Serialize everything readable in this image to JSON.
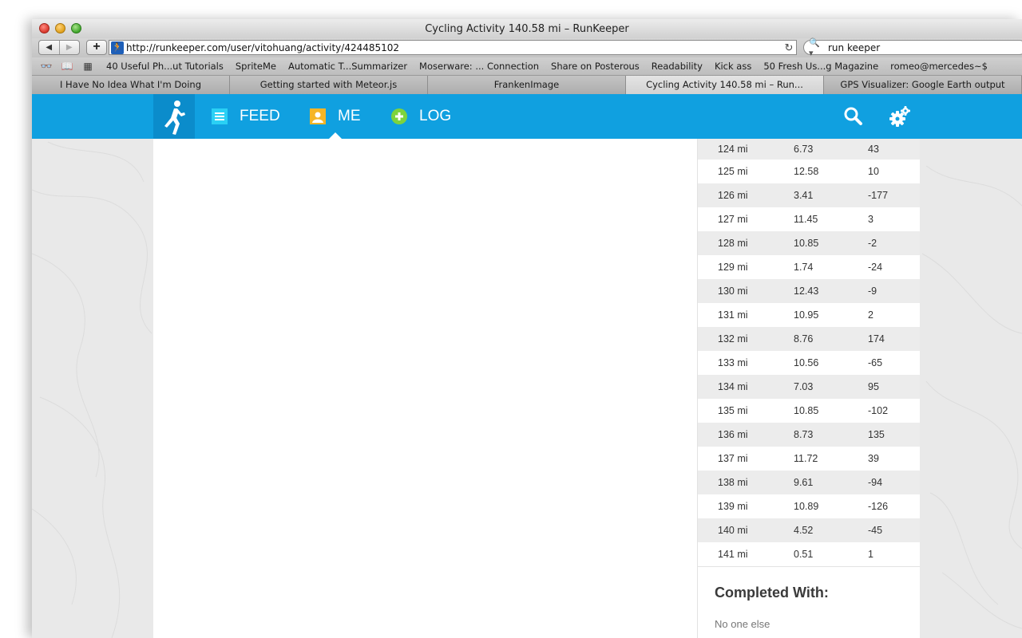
{
  "window": {
    "title": "Cycling Activity 140.58 mi – RunKeeper"
  },
  "toolbar": {
    "back_glyph": "◀",
    "forward_glyph": "▶",
    "add_glyph": "+",
    "favicon_glyph": "🏃",
    "url": "http://runkeeper.com/user/vitohuang/activity/424485102",
    "reload_glyph": "↻",
    "search_glyph": "🔍▾",
    "search_value": "run keeper"
  },
  "bookmarks": {
    "icons": {
      "reading_list": "👓",
      "bookmarks_book": "📖",
      "top_sites": "▦"
    },
    "items": [
      "40 Useful Ph...ut Tutorials",
      "SpriteMe",
      "Automatic T...Summarizer",
      "Moserware: ... Connection",
      "Share on Posterous",
      "Readability",
      "Kick ass",
      "50 Fresh Us...g Magazine",
      "romeo@mercedes~$"
    ]
  },
  "tabs": [
    {
      "label": "I Have No Idea What I'm Doing"
    },
    {
      "label": "Getting started with Meteor.js"
    },
    {
      "label": "FrankenImage"
    },
    {
      "label": "Cycling Activity 140.58 mi – Run..."
    },
    {
      "label": "GPS Visualizer: Google Earth output"
    }
  ],
  "nav": {
    "feed": "FEED",
    "me": "ME",
    "log": "LOG",
    "colors": {
      "bar": "#10a0e0",
      "logo_bg": "#0b8ccb",
      "feed_icon": "#2ad0f5",
      "me_icon": "#f5b526",
      "log_icon": "#7dd33d"
    }
  },
  "splits": {
    "rows": [
      [
        "124 mi",
        "6.73",
        "43"
      ],
      [
        "125 mi",
        "12.58",
        "10"
      ],
      [
        "126 mi",
        "3.41",
        "-177"
      ],
      [
        "127 mi",
        "11.45",
        "3"
      ],
      [
        "128 mi",
        "10.85",
        "-2"
      ],
      [
        "129 mi",
        "1.74",
        "-24"
      ],
      [
        "130 mi",
        "12.43",
        "-9"
      ],
      [
        "131 mi",
        "10.95",
        "2"
      ],
      [
        "132 mi",
        "8.76",
        "174"
      ],
      [
        "133 mi",
        "10.56",
        "-65"
      ],
      [
        "134 mi",
        "7.03",
        "95"
      ],
      [
        "135 mi",
        "10.85",
        "-102"
      ],
      [
        "136 mi",
        "8.73",
        "135"
      ],
      [
        "137 mi",
        "11.72",
        "39"
      ],
      [
        "138 mi",
        "9.61",
        "-94"
      ],
      [
        "139 mi",
        "10.89",
        "-126"
      ],
      [
        "140 mi",
        "4.52",
        "-45"
      ],
      [
        "141 mi",
        "0.51",
        "1"
      ]
    ]
  },
  "completed": {
    "title": "Completed With:",
    "text": "No one else"
  }
}
